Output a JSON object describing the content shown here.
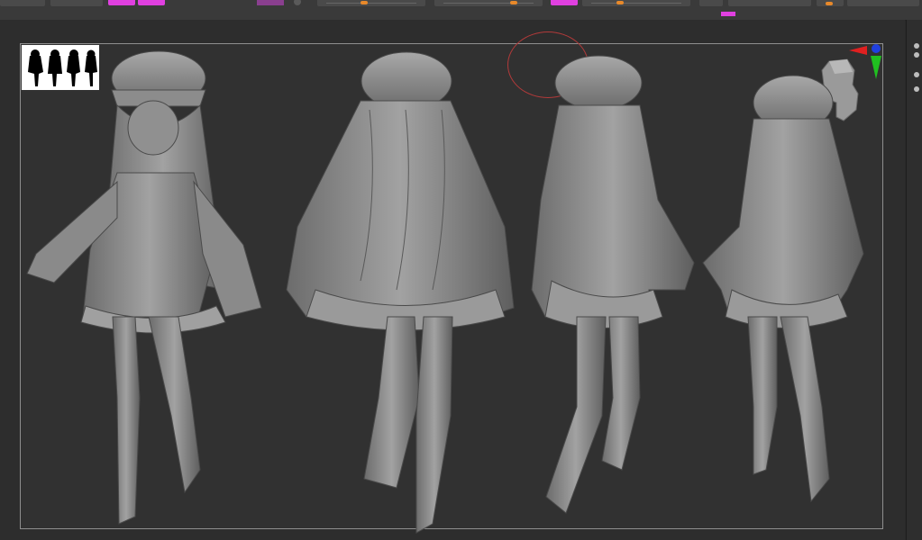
{
  "toolbar": {
    "left_value": "",
    "mid_value": "",
    "right_value": "",
    "far_right_value": ""
  },
  "canvas": {
    "figure_count": 4,
    "views": [
      "front",
      "back",
      "side",
      "three-quarter"
    ]
  },
  "colors": {
    "accent_magenta": "#e040e0",
    "slider_orange": "#e8892a",
    "model_gray": "#8a8a8a",
    "frame_border": "#8e8e8e"
  },
  "icons": {
    "gizmo": "axis-gizmo-icon",
    "head": "head-preview-icon"
  }
}
